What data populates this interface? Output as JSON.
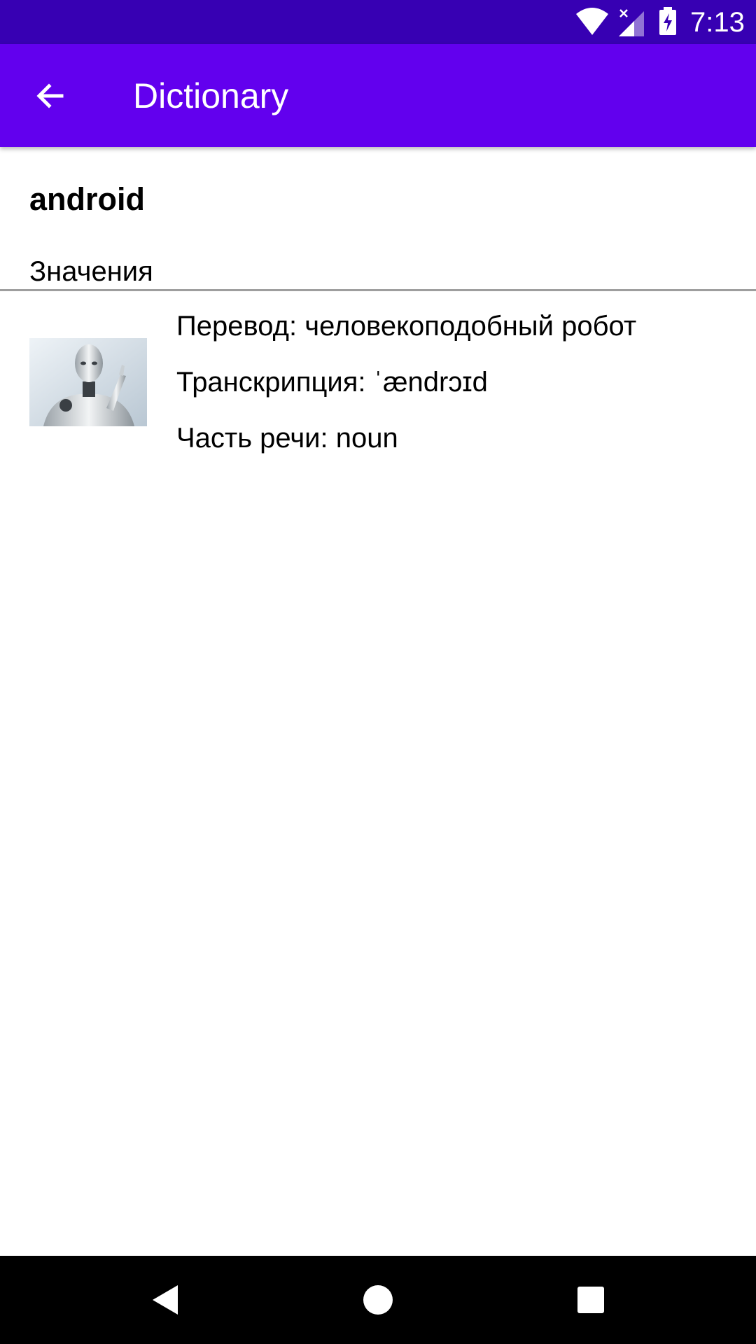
{
  "status_bar": {
    "time": "7:13",
    "icons": [
      "wifi-icon",
      "cell-signal-icon",
      "battery-charging-icon"
    ]
  },
  "app_bar": {
    "back_icon": "arrow-back-icon",
    "title": "Dictionary",
    "background": "#6200ee"
  },
  "entry": {
    "word": "android",
    "section_label": "Значения",
    "meanings": [
      {
        "image": "robot-image",
        "translation": "Перевод: человекоподобный робот",
        "transcription": "Транскрипция: ˈændrɔɪd",
        "part_of_speech": "Часть речи: noun"
      }
    ]
  },
  "nav_bar": {
    "buttons": [
      "back-triangle-icon",
      "home-circle-icon",
      "recents-square-icon"
    ]
  },
  "colors": {
    "status_bar": "#3700b3",
    "app_bar": "#6200ee",
    "divider": "#9e9e9e"
  }
}
